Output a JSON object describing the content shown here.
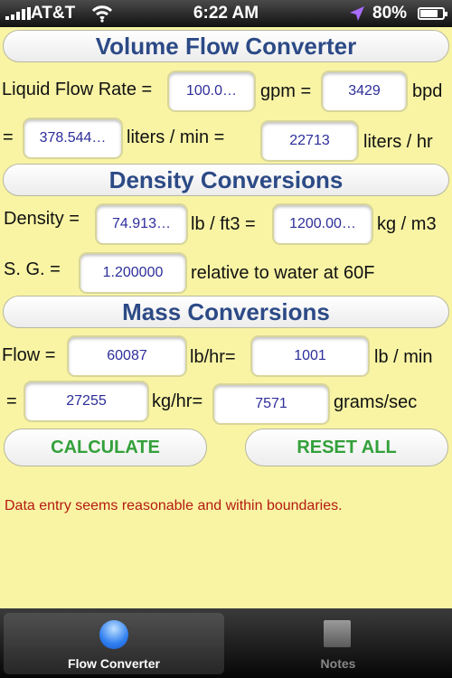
{
  "status_bar": {
    "carrier": "AT&T",
    "time": "6:22 AM",
    "battery_percent": "80%",
    "battery_level": 0.8,
    "icons": [
      "signal-bars-icon",
      "wifi-icon",
      "location-arrow-icon",
      "battery-icon"
    ]
  },
  "volume": {
    "title": "Volume Flow Converter",
    "row1_label": "Liquid Flow Rate =",
    "gpm_value": "100.0…",
    "gpm_unit": "gpm =",
    "bpd_value": "3429",
    "bpd_unit": "bpd",
    "row2_eq": "=",
    "lpm_value": "378.544…",
    "lpm_unit": "liters / min =",
    "lph_value": "22713",
    "lph_unit": "liters / hr"
  },
  "density": {
    "title": "Density Conversions",
    "row1_label": "Density =",
    "lbft3_value": "74.913…",
    "lbft3_unit": "lb / ft3 =",
    "kgm3_value": "1200.00…",
    "kgm3_unit": "kg / m3",
    "sg_label": "S. G. =",
    "sg_value": "1.200000",
    "sg_note": "relative to water at 60F"
  },
  "mass": {
    "title": "Mass Conversions",
    "row1_label": "Flow =",
    "lbhr_value": "60087",
    "lbhr_unit": "lb/hr=",
    "lbmin_value": "1001",
    "lbmin_unit": "lb / min",
    "row2_eq": "=",
    "kghr_value": "27255",
    "kghr_unit": "kg/hr=",
    "gs_value": "7571",
    "gs_unit": "grams/sec"
  },
  "actions": {
    "calculate_label": "CALCULATE",
    "reset_label": "RESET ALL",
    "accent_color": "#33a03a"
  },
  "message": "Data entry seems reasonable and within boundaries.",
  "message_color": "#b51a10",
  "tabs": [
    {
      "label": "Flow Converter",
      "active": true,
      "icon": "globe-icon"
    },
    {
      "label": "Notes",
      "active": false,
      "icon": "square-icon"
    }
  ],
  "colors": {
    "background": "#f8f4a4",
    "header_text": "#2c4a86",
    "field_text": "#2d2e9a"
  }
}
